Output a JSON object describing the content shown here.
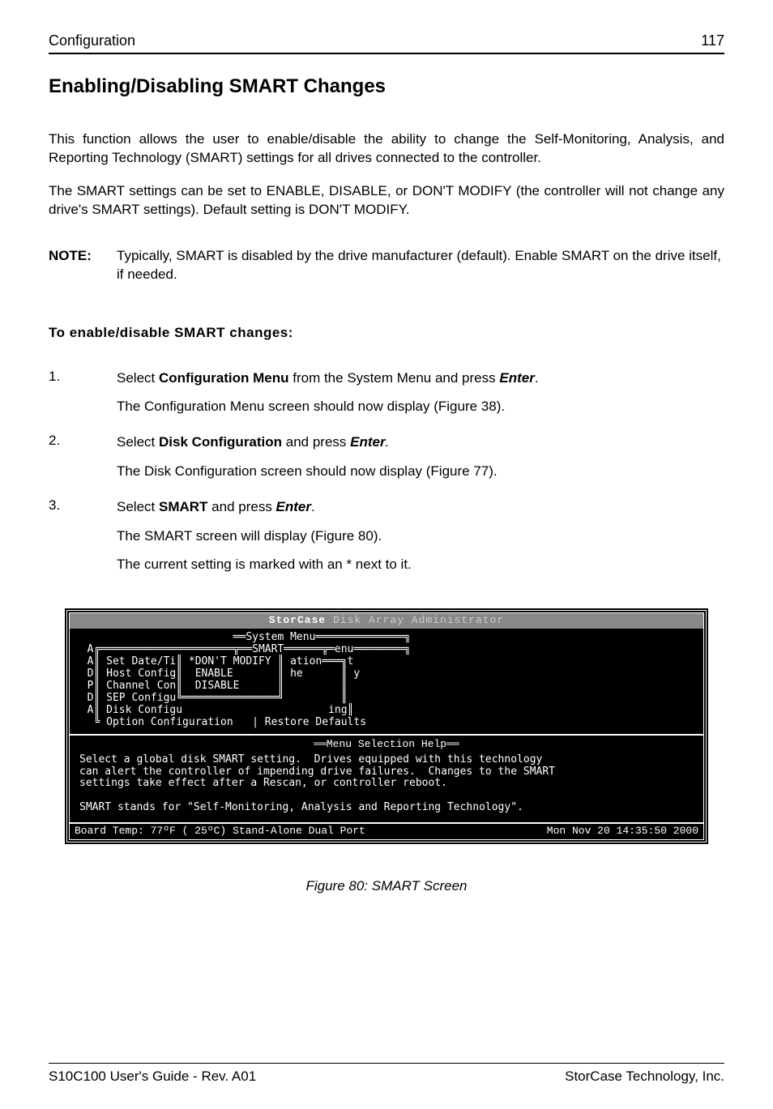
{
  "header": {
    "left": "Configuration",
    "right": "117"
  },
  "title": "Enabling/Disabling SMART Changes",
  "para1": "This function allows the user to enable/disable the ability to change the Self-Monitoring, Analysis, and Reporting Technology (SMART) settings for all drives connected to the controller.",
  "para2": "The SMART settings can be set to ENABLE, DISABLE, or DON'T MODIFY (the controller will not change any drive's SMART settings).  Default setting is DON'T MODIFY.",
  "note": {
    "label": "NOTE:",
    "body": "Typically, SMART is disabled by the drive manufacturer (default).  Enable SMART on the drive itself, if needed."
  },
  "subhead": "To enable/disable SMART changes:",
  "steps": [
    {
      "num": "1.",
      "lines": [
        {
          "pre": "Select ",
          "bold1": "Configuration Menu",
          "mid": " from the System Menu and press ",
          "enter": "Enter",
          "post": "."
        },
        {
          "plain": "The Configuration Menu screen should now display (Figure 38)."
        }
      ]
    },
    {
      "num": "2.",
      "lines": [
        {
          "pre": "Select ",
          "bold1": "Disk Configuration",
          "mid": " and press ",
          "enter": "Enter",
          "post": "."
        },
        {
          "plain": "The Disk Configuration screen should now display (Figure 77)."
        }
      ]
    },
    {
      "num": "3.",
      "lines": [
        {
          "pre": "Select ",
          "bold1": "SMART",
          "mid": " and press ",
          "enter": "Enter",
          "post": "."
        },
        {
          "plain": "The SMART screen will display (Figure 80)."
        },
        {
          "plain": "The current setting is marked with an * next to it."
        }
      ]
    }
  ],
  "terminal": {
    "brand": "StorCase",
    "brand_sub": "Disk Array Administrator",
    "body": "                         ══System Menu══════════════╗\n  A╔═════════════════════╦══SMART══════╦═enu════════╗\n  A║ Set Date/Ti║ *DON'T MODIFY ║ ation═══╗t\n  D║ Host Config║  ENABLE       ║ he      ║ y\n  P║ Channel Con║  DISABLE      ║         ║\n  D║ SEP Configu╚═══════════════╝         ║\n  A║ Disk Configu                       ing║\n   ╚ Option Configuration   | Restore Defaults\n",
    "help_title": "══Menu Selection Help══",
    "help_body": "Select a global disk SMART setting.  Drives equipped with this technology\ncan alert the controller of impending drive failures.  Changes to the SMART\nsettings take effect after a Rescan, or controller reboot.\n\nSMART stands for \"Self-Monitoring, Analysis and Reporting Technology\".",
    "status_left": "Board Temp:  77ºF ( 25ºC)  Stand-Alone Dual Port",
    "status_right": "Mon Nov 20 14:35:50 2000"
  },
  "figure_caption": "Figure 80:   SMART Screen",
  "footer": {
    "left": "S10C100 User's Guide - Rev. A01",
    "right": "StorCase Technology, Inc."
  }
}
